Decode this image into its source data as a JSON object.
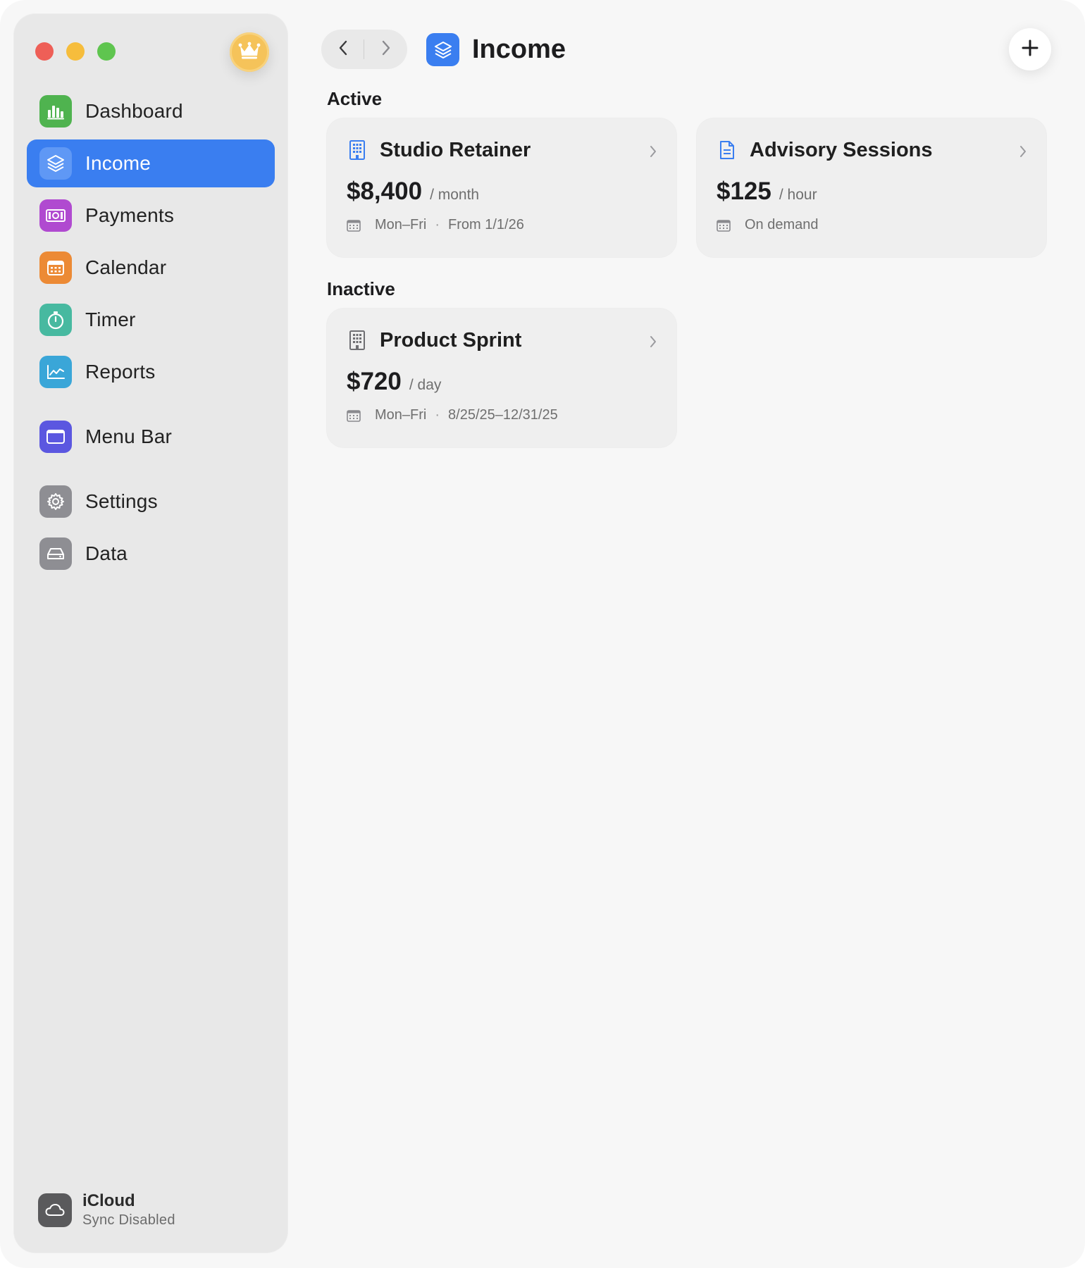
{
  "sidebar": {
    "items": [
      {
        "label": "Dashboard",
        "icon": "chart-bar-icon",
        "color": "#4fb34f"
      },
      {
        "label": "Income",
        "icon": "layers-icon",
        "color": "#3a7ef0"
      },
      {
        "label": "Payments",
        "icon": "banknote-icon",
        "color": "#b04ad0"
      },
      {
        "label": "Calendar",
        "icon": "calendar-icon",
        "color": "#ec8a35"
      },
      {
        "label": "Timer",
        "icon": "stopwatch-icon",
        "color": "#47b9a0"
      },
      {
        "label": "Reports",
        "icon": "line-chart-icon",
        "color": "#3aa6d8"
      },
      {
        "label": "Menu Bar",
        "icon": "window-icon",
        "color": "#5b57e0"
      },
      {
        "label": "Settings",
        "icon": "gear-icon",
        "color": "#8e8e93"
      },
      {
        "label": "Data",
        "icon": "drive-icon",
        "color": "#8e8e93"
      }
    ],
    "active_index": 1,
    "icloud": {
      "title": "iCloud",
      "subtitle": "Sync Disabled"
    }
  },
  "header": {
    "title": "Income"
  },
  "sections": {
    "active": {
      "title": "Active",
      "cards": [
        {
          "name": "Studio Retainer",
          "icon": "building-icon",
          "amount": "$8,400",
          "unit": "/ month",
          "schedule": "Mon–Fri",
          "range": "From 1/1/26"
        },
        {
          "name": "Advisory Sessions",
          "icon": "document-icon",
          "amount": "$125",
          "unit": "/ hour",
          "schedule": "On demand"
        }
      ]
    },
    "inactive": {
      "title": "Inactive",
      "cards": [
        {
          "name": "Product Sprint",
          "icon": "building-icon",
          "amount": "$720",
          "unit": "/ day",
          "schedule": "Mon–Fri",
          "range": "8/25/25–12/31/25"
        }
      ]
    }
  },
  "colors": {
    "accent": "#3a7ef0",
    "premium": "#f5c35a"
  }
}
